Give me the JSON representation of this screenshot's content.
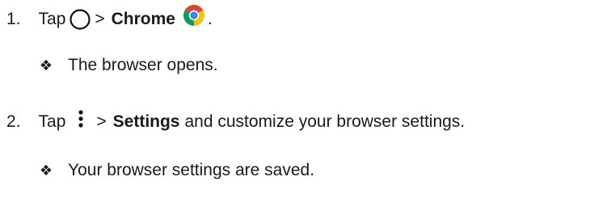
{
  "steps": [
    {
      "number": "1.",
      "prefix": "Tap",
      "home_icon": "home-circle-icon",
      "separator": ">",
      "target": "Chrome",
      "app_icon": "chrome-icon",
      "suffix": ".",
      "result_bullet": "❖",
      "result": "The browser opens."
    },
    {
      "number": "2.",
      "prefix": "Tap",
      "menu_icon": "more-vert-icon",
      "separator": ">",
      "target": "Settings",
      "suffix": "and customize your browser settings.",
      "result_bullet": "❖",
      "result": "Your browser settings are saved."
    }
  ]
}
